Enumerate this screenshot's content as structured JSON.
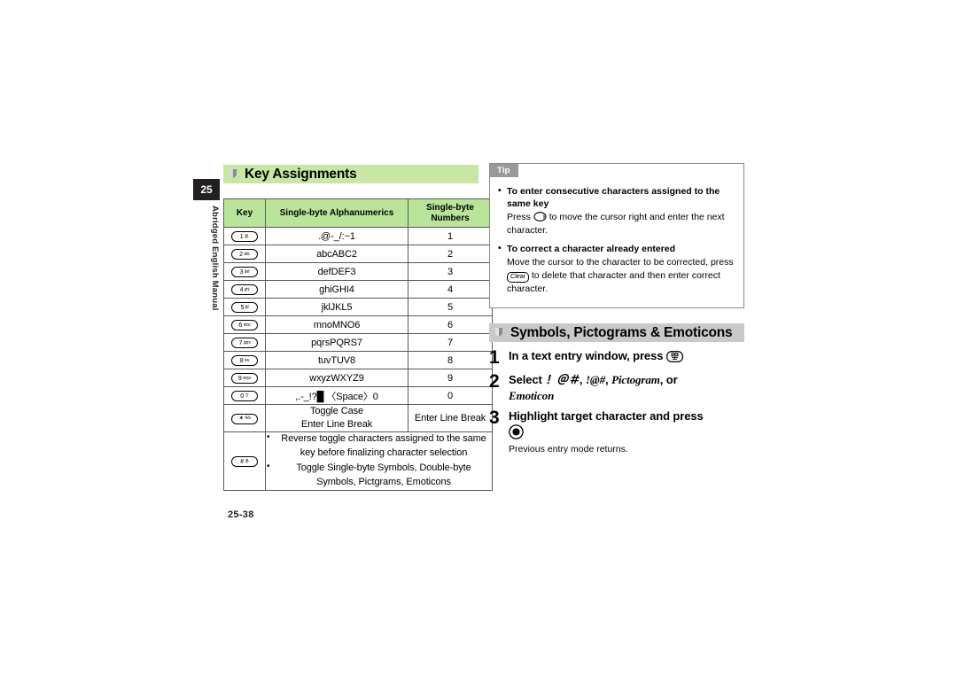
{
  "sidebar": {
    "chapter_number": "25",
    "vertical_label": "Abridged English Manual"
  },
  "footer": {
    "page_number": "25-38"
  },
  "sections": {
    "key_assignments": {
      "title": "Key Assignments",
      "accent_color": "#c8e6a4"
    },
    "symbols": {
      "title": "Symbols, Pictograms & Emoticons",
      "accent_color": "#c9c9c9"
    }
  },
  "key_table": {
    "header_color": "#b9e59b",
    "columns": [
      "Key",
      "Single-byte Alphanumerics",
      "Single-byte Numbers"
    ],
    "rows": [
      {
        "key_num": "1",
        "key_sub": "@.",
        "alpha": ".@-_/:~1",
        "num": "1"
      },
      {
        "key_num": "2",
        "key_sub": "abc",
        "alpha": "abcABC2",
        "num": "2"
      },
      {
        "key_num": "3",
        "key_sub": "def",
        "alpha": "defDEF3",
        "num": "3"
      },
      {
        "key_num": "4",
        "key_sub": "ghi",
        "alpha": "ghiGHI4",
        "num": "4"
      },
      {
        "key_num": "5",
        "key_sub": "jkl",
        "alpha": "jklJKL5",
        "num": "5"
      },
      {
        "key_num": "6",
        "key_sub": "mno",
        "alpha": "mnoMNO6",
        "num": "6"
      },
      {
        "key_num": "7",
        "key_sub": "pqrs",
        "alpha": "pqrsPQRS7",
        "num": "7"
      },
      {
        "key_num": "8",
        "key_sub": "tuv",
        "alpha": "tuvTUV8",
        "num": "8"
      },
      {
        "key_num": "9",
        "key_sub": "wxyz",
        "alpha": "wxyzWXYZ9",
        "num": "9"
      },
      {
        "key_num": "0",
        "key_sub": "ワ",
        "alpha": ",.-_!?█ 〈Space〉0",
        "num": "0"
      }
    ],
    "star_row": {
      "key_num": "✶",
      "key_sub": "A/a",
      "alpha_line1": "Toggle Case",
      "alpha_line2": "Enter Line Break",
      "num": "Enter Line Break"
    },
    "hash_row": {
      "key_num": "#",
      "key_sub": "あ",
      "bullets": [
        "Reverse toggle characters assigned to the same key before finalizing character selection",
        "Toggle Single-byte Symbols, Double-byte Symbols, Pictgrams, Emoticons"
      ]
    }
  },
  "tip": {
    "label": "Tip",
    "items": [
      {
        "heading": "To enter consecutive characters assigned to the same key",
        "body_before": "Press",
        "body_after": "to move the cursor right and enter the next character."
      },
      {
        "heading": "To correct a character already entered",
        "body_before": "Move the cursor to the character to be corrected, press",
        "glyph_label": "Clear",
        "body_after": "to delete that character and then enter correct character."
      }
    ]
  },
  "steps": [
    {
      "number": "1",
      "text_before": "In a text entry window, press",
      "text_after": ""
    },
    {
      "number": "2",
      "text_before": "Select",
      "option1": "！＠＃",
      "option2": "!@#",
      "option3": "Pictogram",
      "conj": ", or",
      "option4": "Emoticon"
    },
    {
      "number": "3",
      "text_before": "Highlight target character and press",
      "note": "Previous entry mode returns."
    }
  ]
}
